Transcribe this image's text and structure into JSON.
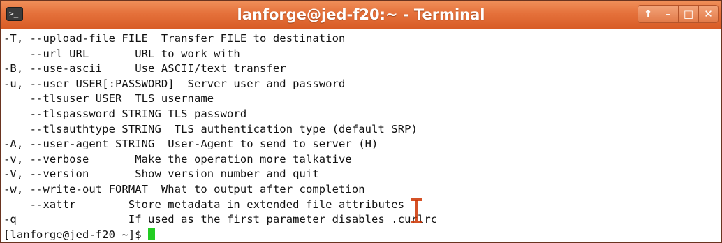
{
  "window": {
    "title": "lanforge@jed-f20:~ - Terminal",
    "app_icon_glyph": ">_",
    "controls": {
      "up": "↑",
      "minimize": "–",
      "maximize": "□",
      "close": "✕"
    }
  },
  "terminal": {
    "lines": [
      "-T, --upload-file FILE  Transfer FILE to destination",
      "    --url URL       URL to work with",
      "-B, --use-ascii     Use ASCII/text transfer",
      "-u, --user USER[:PASSWORD]  Server user and password",
      "    --tlsuser USER  TLS username",
      "    --tlspassword STRING TLS password",
      "    --tlsauthtype STRING  TLS authentication type (default SRP)",
      "-A, --user-agent STRING  User-Agent to send to server (H)",
      "-v, --verbose       Make the operation more talkative",
      "-V, --version       Show version number and quit",
      "-w, --write-out FORMAT  What to output after completion",
      "    --xattr        Store metadata in extended file attributes",
      "-q                 If used as the first parameter disables .curlrc"
    ],
    "prompt": "[lanforge@jed-f20 ~]$ "
  },
  "colors": {
    "titlebar": "#e5713b",
    "text": "#111111",
    "cursor": "#22cc22",
    "background": "#ffffff"
  }
}
